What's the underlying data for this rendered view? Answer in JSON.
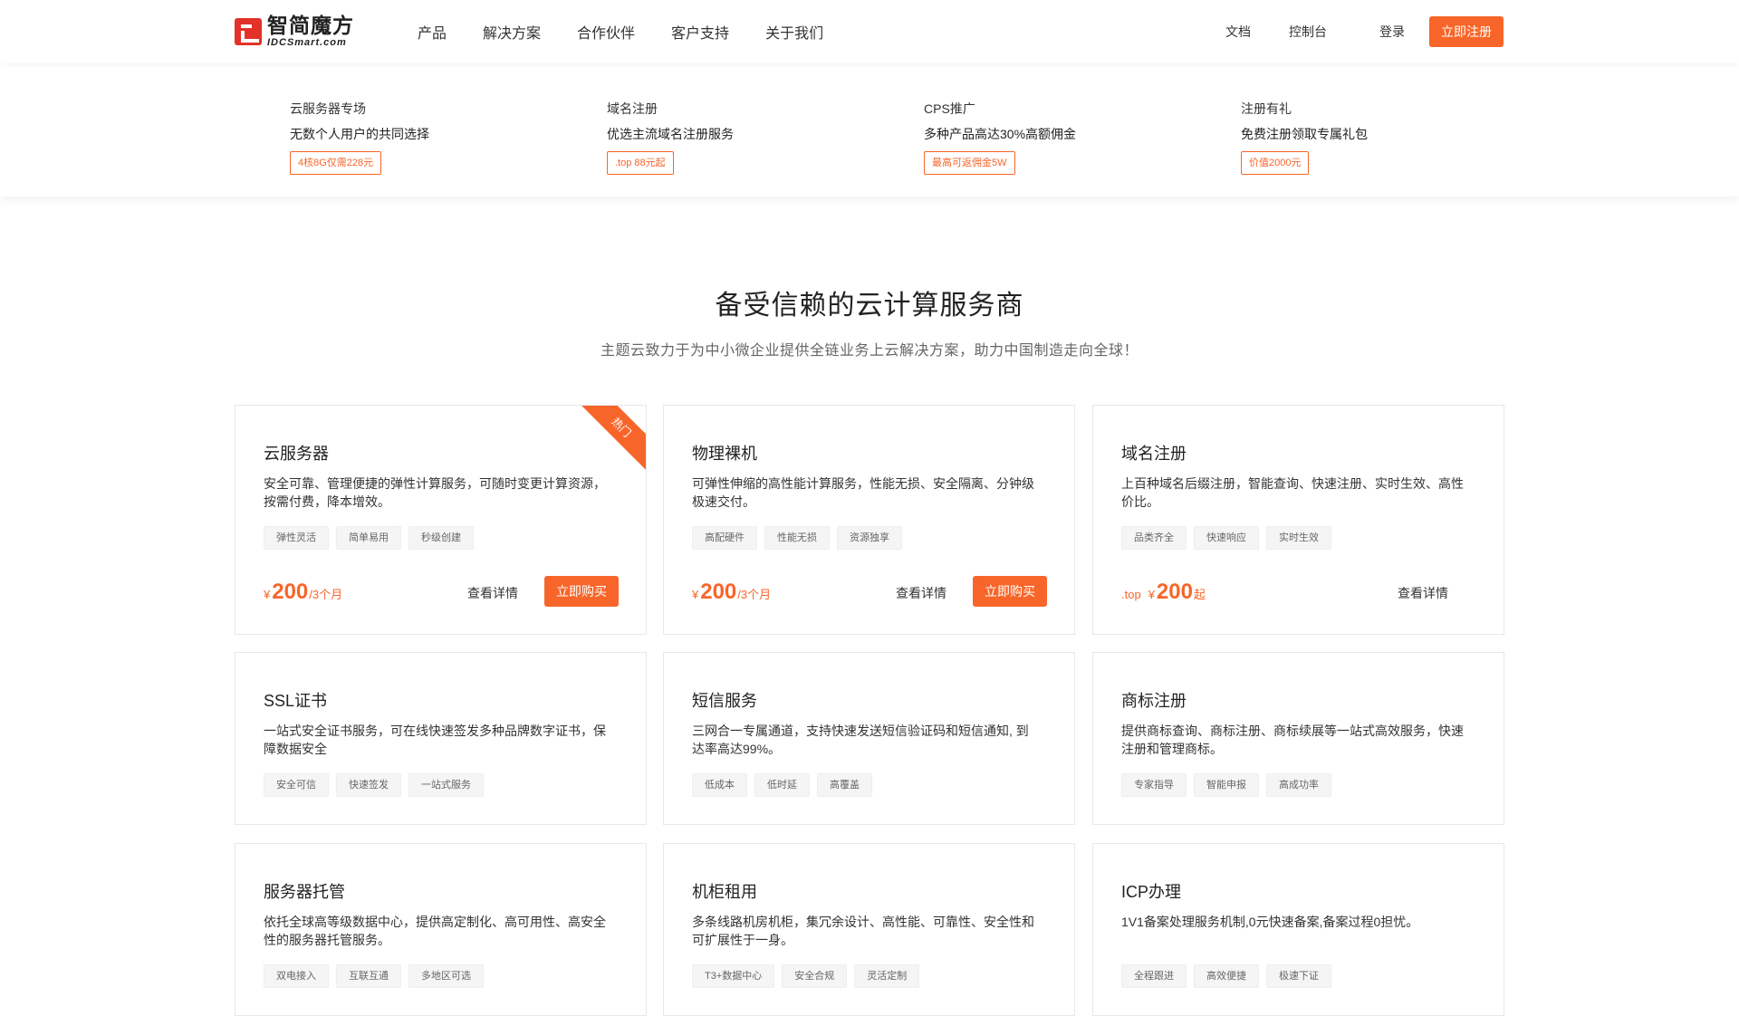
{
  "header": {
    "logo_cn": "智简魔方",
    "logo_en": "IDCSmart.com",
    "nav": [
      "产品",
      "解决方案",
      "合作伙伴",
      "客户支持",
      "关于我们"
    ],
    "docs": "文档",
    "console": "控制台",
    "login": "登录",
    "register": "立即注册"
  },
  "promos": [
    {
      "title": "云服务器专场",
      "desc": "无数个人用户的共同选择",
      "tag": "4核8G仅需228元"
    },
    {
      "title": "域名注册",
      "desc": "优选主流域名注册服务",
      "tag": ".top 88元起"
    },
    {
      "title": "CPS推广",
      "desc": "多种产品高达30%高额佣金",
      "tag": "最高可返佣金5W"
    },
    {
      "title": "注册有礼",
      "desc": "免费注册领取专属礼包",
      "tag": "价值2000元"
    }
  ],
  "section": {
    "title": "备受信赖的云计算服务商",
    "subtitle": "主题云致力于为中小微企业提供全链业务上云解决方案，助力中国制造走向全球！"
  },
  "cards": [
    {
      "name": "云服务器",
      "desc": "安全可靠、管理便捷的弹性计算服务，可随时变更计算资源，按需付费，降本增效。",
      "tags": [
        "弹性灵活",
        "简单易用",
        "秒级创建"
      ],
      "currency": "¥",
      "price": "200",
      "unit": "/3个月",
      "detail": "查看详情",
      "buy": "立即购买",
      "hot": "热门"
    },
    {
      "name": "物理裸机",
      "desc": "可弹性伸缩的高性能计算服务，性能无损、安全隔离、分钟级极速交付。",
      "tags": [
        "高配硬件",
        "性能无损",
        "资源独享"
      ],
      "currency": "¥",
      "price": "200",
      "unit": "/3个月",
      "detail": "查看详情",
      "buy": "立即购买"
    },
    {
      "name": "域名注册",
      "desc": "上百种域名后缀注册，智能查询、快速注册、实时生效、高性价比。",
      "tags": [
        "品类齐全",
        "快速响应",
        "实时生效"
      ],
      "prefix": ".top",
      "currency": "¥",
      "price": "200",
      "unit": "起",
      "detail": "查看详情"
    },
    {
      "name": "SSL证书",
      "desc": "一站式安全证书服务，可在线快速签发多种品牌数字证书，保障数据安全",
      "tags": [
        "安全可信",
        "快速签发",
        "一站式服务"
      ]
    },
    {
      "name": "短信服务",
      "desc": "三网合一专属通道，支持快速发送短信验证码和短信通知, 到达率高达99%。",
      "tags": [
        "低成本",
        "低时延",
        "高覆盖"
      ]
    },
    {
      "name": "商标注册",
      "desc": "提供商标查询、商标注册、商标续展等一站式高效服务，快速注册和管理商标。",
      "tags": [
        "专家指导",
        "智能申报",
        "高成功率"
      ]
    },
    {
      "name": "服务器托管",
      "desc": "依托全球高等级数据中心，提供高定制化、高可用性、高安全性的服务器托管服务。",
      "tags": [
        "双电接入",
        "互联互通",
        "多地区可选"
      ]
    },
    {
      "name": "机柜租用",
      "desc": "多条线路机房机柜，集冗余设计、高性能、可靠性、安全性和可扩展性于一身。",
      "tags": [
        "T3+数据中心",
        "安全合规",
        "灵活定制"
      ]
    },
    {
      "name": "ICP办理",
      "desc": "1V1备案处理服务机制,0元快速备案,备案过程0担忧。",
      "tags": [
        "全程跟进",
        "高效便捷",
        "极速下证"
      ]
    }
  ]
}
